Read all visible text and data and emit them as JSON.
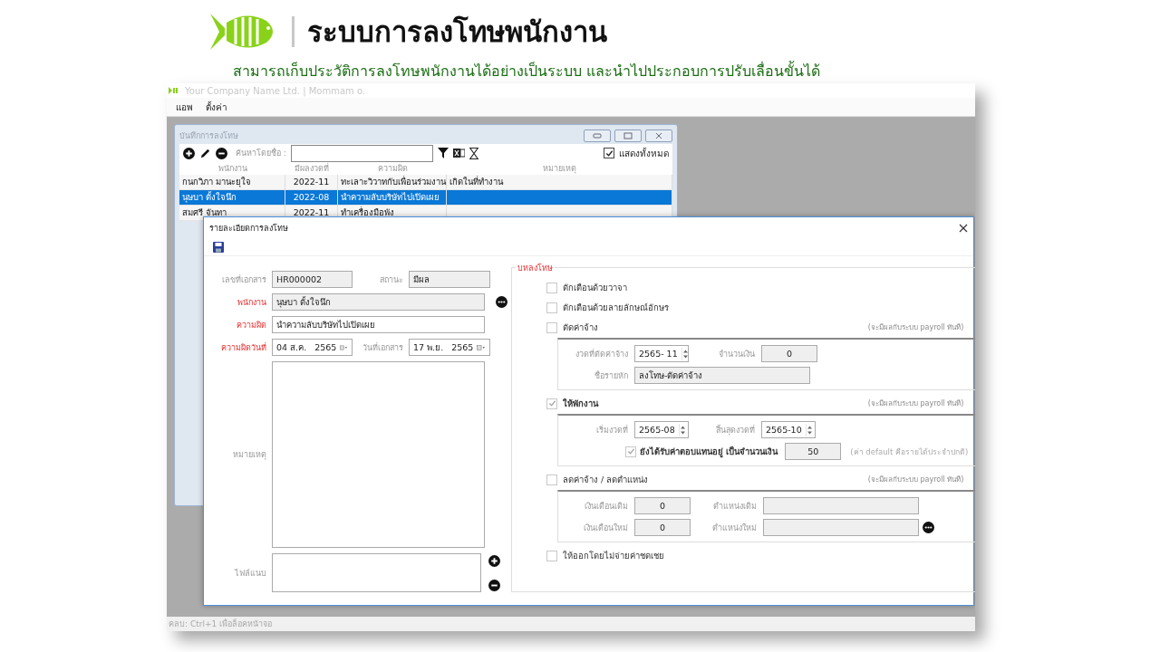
{
  "header": {
    "title": "ระบบการลงโทษพนักงาน",
    "subtitle": "สามารถเก็บประวัติการลงโทษพนักงานได้อย่างเป็นระบบ และนำไปประกอบการปรับเลื่อนขั้นได้"
  },
  "app": {
    "title": "Your Company Name Ltd. | Mommam o.",
    "menu": [
      "แอพ",
      "ตั้งค่า"
    ],
    "status_bar": "คลบ: Ctrl+1 เพื่อล็อคหน้าจอ"
  },
  "list_window": {
    "title": "บันทึกการลงโทษ",
    "search_label": "ค้นหาโดยชื่อ :",
    "show_all": {
      "label": "แสดงทั้งหมด",
      "checked": true
    },
    "columns": [
      "พนักงาน",
      "มีผลงวดที่",
      "ความผิด",
      "หมายเหตุ"
    ],
    "rows": [
      {
        "cells": [
          "กนกวิภา มานะยุใจ",
          "2022-11",
          "ทะเลาะวิวาทกับเพื่อนร่วมงาน",
          "เกิดในที่ทำงาน"
        ],
        "selected": false
      },
      {
        "cells": [
          "นุษบา ตั้งใจนึก",
          "2022-08",
          "นำความลับบริษัทไปเปิดเผย"
        ],
        "selected": true
      },
      {
        "cells": [
          "สมศรี จันทา",
          "2022-11",
          "ทำเครื่องมือพัง"
        ],
        "selected": false
      }
    ]
  },
  "dialog": {
    "title": "รายละเอียดการลงโทษ",
    "doc_no": {
      "label": "เลขที่เอกสาร",
      "value": "HR000002",
      "required": false
    },
    "status": {
      "label": "สถานะ",
      "value": "มีผล",
      "required": false
    },
    "employee": {
      "label": "พนักงาน",
      "value": "นุษบา ตั้งใจนึก",
      "required": true
    },
    "offense": {
      "label": "ความผิด",
      "value": "นำความลับบริษัทไปเปิดเผย",
      "required": true
    },
    "offense_date": {
      "label": "ความผิดวันที่",
      "value": "04 ส.ค.   2565",
      "required": true
    },
    "doc_date": {
      "label": "วันที่เอกสาร",
      "value": "17 พ.ย.   2565",
      "required": false
    },
    "remark": {
      "label": "หมายเหตุ",
      "required": false
    },
    "attachment": {
      "label": "ไฟล์แนบ",
      "required": false
    },
    "penalties": {
      "title": "บทลงโทษ",
      "options": [
        {
          "label": "ตักเตือนด้วยวาจา",
          "checked": false
        },
        {
          "label": "ตักเตือนด้วยลายลักษณ์อักษร",
          "checked": false
        },
        {
          "label": "ตัดค่าจ้าง",
          "checked": false,
          "note": "(จะมีผลกับระบบ payroll ทันที)",
          "rows": [
            [
              {
                "kind": "spin",
                "label": "งวดที่ตัดค่าจ้าง",
                "value": "2565- 11"
              },
              {
                "kind": "number",
                "label": "จำนวนเงิน",
                "value": "0"
              }
            ],
            [
              {
                "kind": "wide",
                "label": "ชื่อรายหัก",
                "value": "ลงโทษ-ตัดค่าจ้าง"
              }
            ]
          ]
        },
        {
          "label": "ให้พักงาน",
          "checked": true,
          "note": "(จะมีผลกับระบบ payroll ทันที)",
          "rows": [
            [
              {
                "kind": "spin",
                "label": "เริ่มงวดที่",
                "value": "2565-08"
              },
              {
                "kind": "spin",
                "label": "สิ้นสุดงวดที่",
                "value": "2565-10"
              }
            ],
            [
              {
                "kind": "check",
                "label": "ยังได้รับค่าตอบแทนอยู่ เป็นจำนวนเงิน",
                "checked": true,
                "value": "50",
                "hint": "(ค่า default คือรายได้ประจำปกติ)"
              }
            ]
          ]
        },
        {
          "label": "ลดค่าจ้าง / ลดตำแหน่ง",
          "checked": false,
          "note": "(จะมีผลกับระบบ payroll ทันที)",
          "rows": [
            [
              {
                "kind": "number",
                "label": "เงินเดือนเดิม",
                "value": "0"
              },
              {
                "kind": "long",
                "label": "ตำแหน่งเดิม"
              }
            ],
            [
              {
                "kind": "number",
                "label": "เงินเดือนใหม่",
                "value": "0"
              },
              {
                "kind": "long",
                "label": "ตำแหน่งใหม่",
                "more": true
              }
            ]
          ]
        },
        {
          "label": "ให้ออกโดยไม่จ่ายค่าชดเชย",
          "checked": false
        }
      ]
    }
  }
}
